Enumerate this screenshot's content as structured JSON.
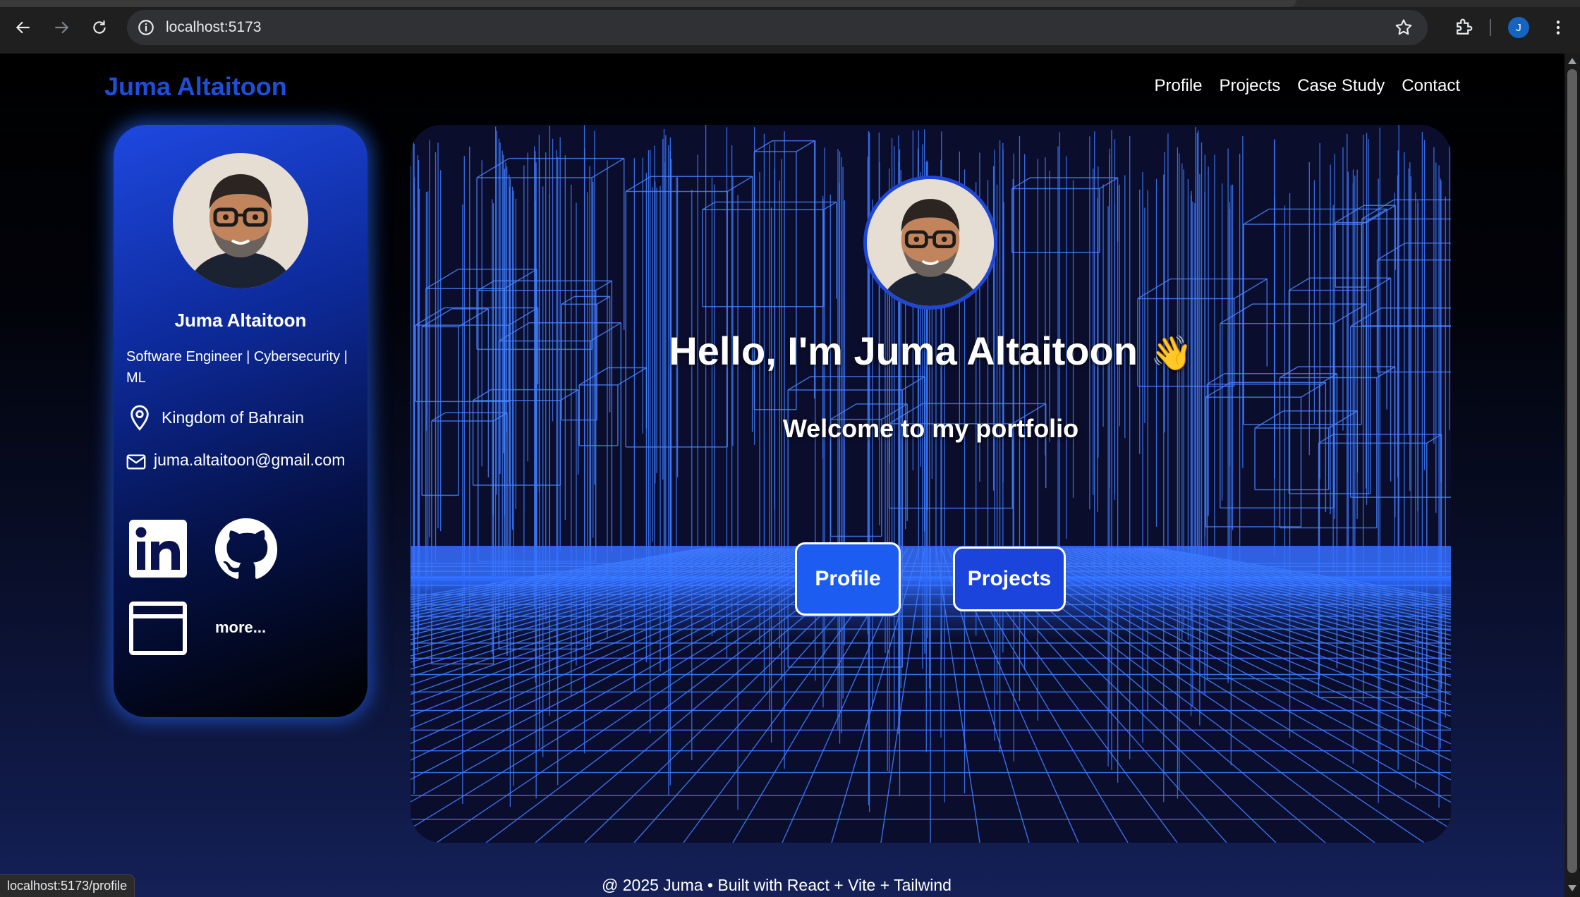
{
  "browser": {
    "url": "localhost:5173",
    "profile_initial": "J",
    "status_url": "localhost:5173/profile"
  },
  "site": {
    "brand": "Juma Altaitoon",
    "nav": [
      "Profile",
      "Projects",
      "Case Study",
      "Contact"
    ]
  },
  "card": {
    "name": "Juma Altaitoon",
    "role": "Software Engineer | Cybersecurity | ML",
    "location": "Kingdom of Bahrain",
    "email": "juma.altaitoon@gmail.com",
    "links": [
      "linkedin-icon",
      "github-icon",
      "website-icon"
    ],
    "more_label": "more..."
  },
  "hero": {
    "greeting": "Hello, I'm Juma Altaitoon",
    "wave": "👋",
    "subtitle": "Welcome to my portfolio",
    "buttons": [
      "Profile",
      "Projects"
    ]
  },
  "footer": "@ 2025 Juma • Built with React + Vite + Tailwind",
  "colors": {
    "accent": "#1d4fd8",
    "grid": "#3d7bff",
    "card_glow": "#2563eb"
  }
}
